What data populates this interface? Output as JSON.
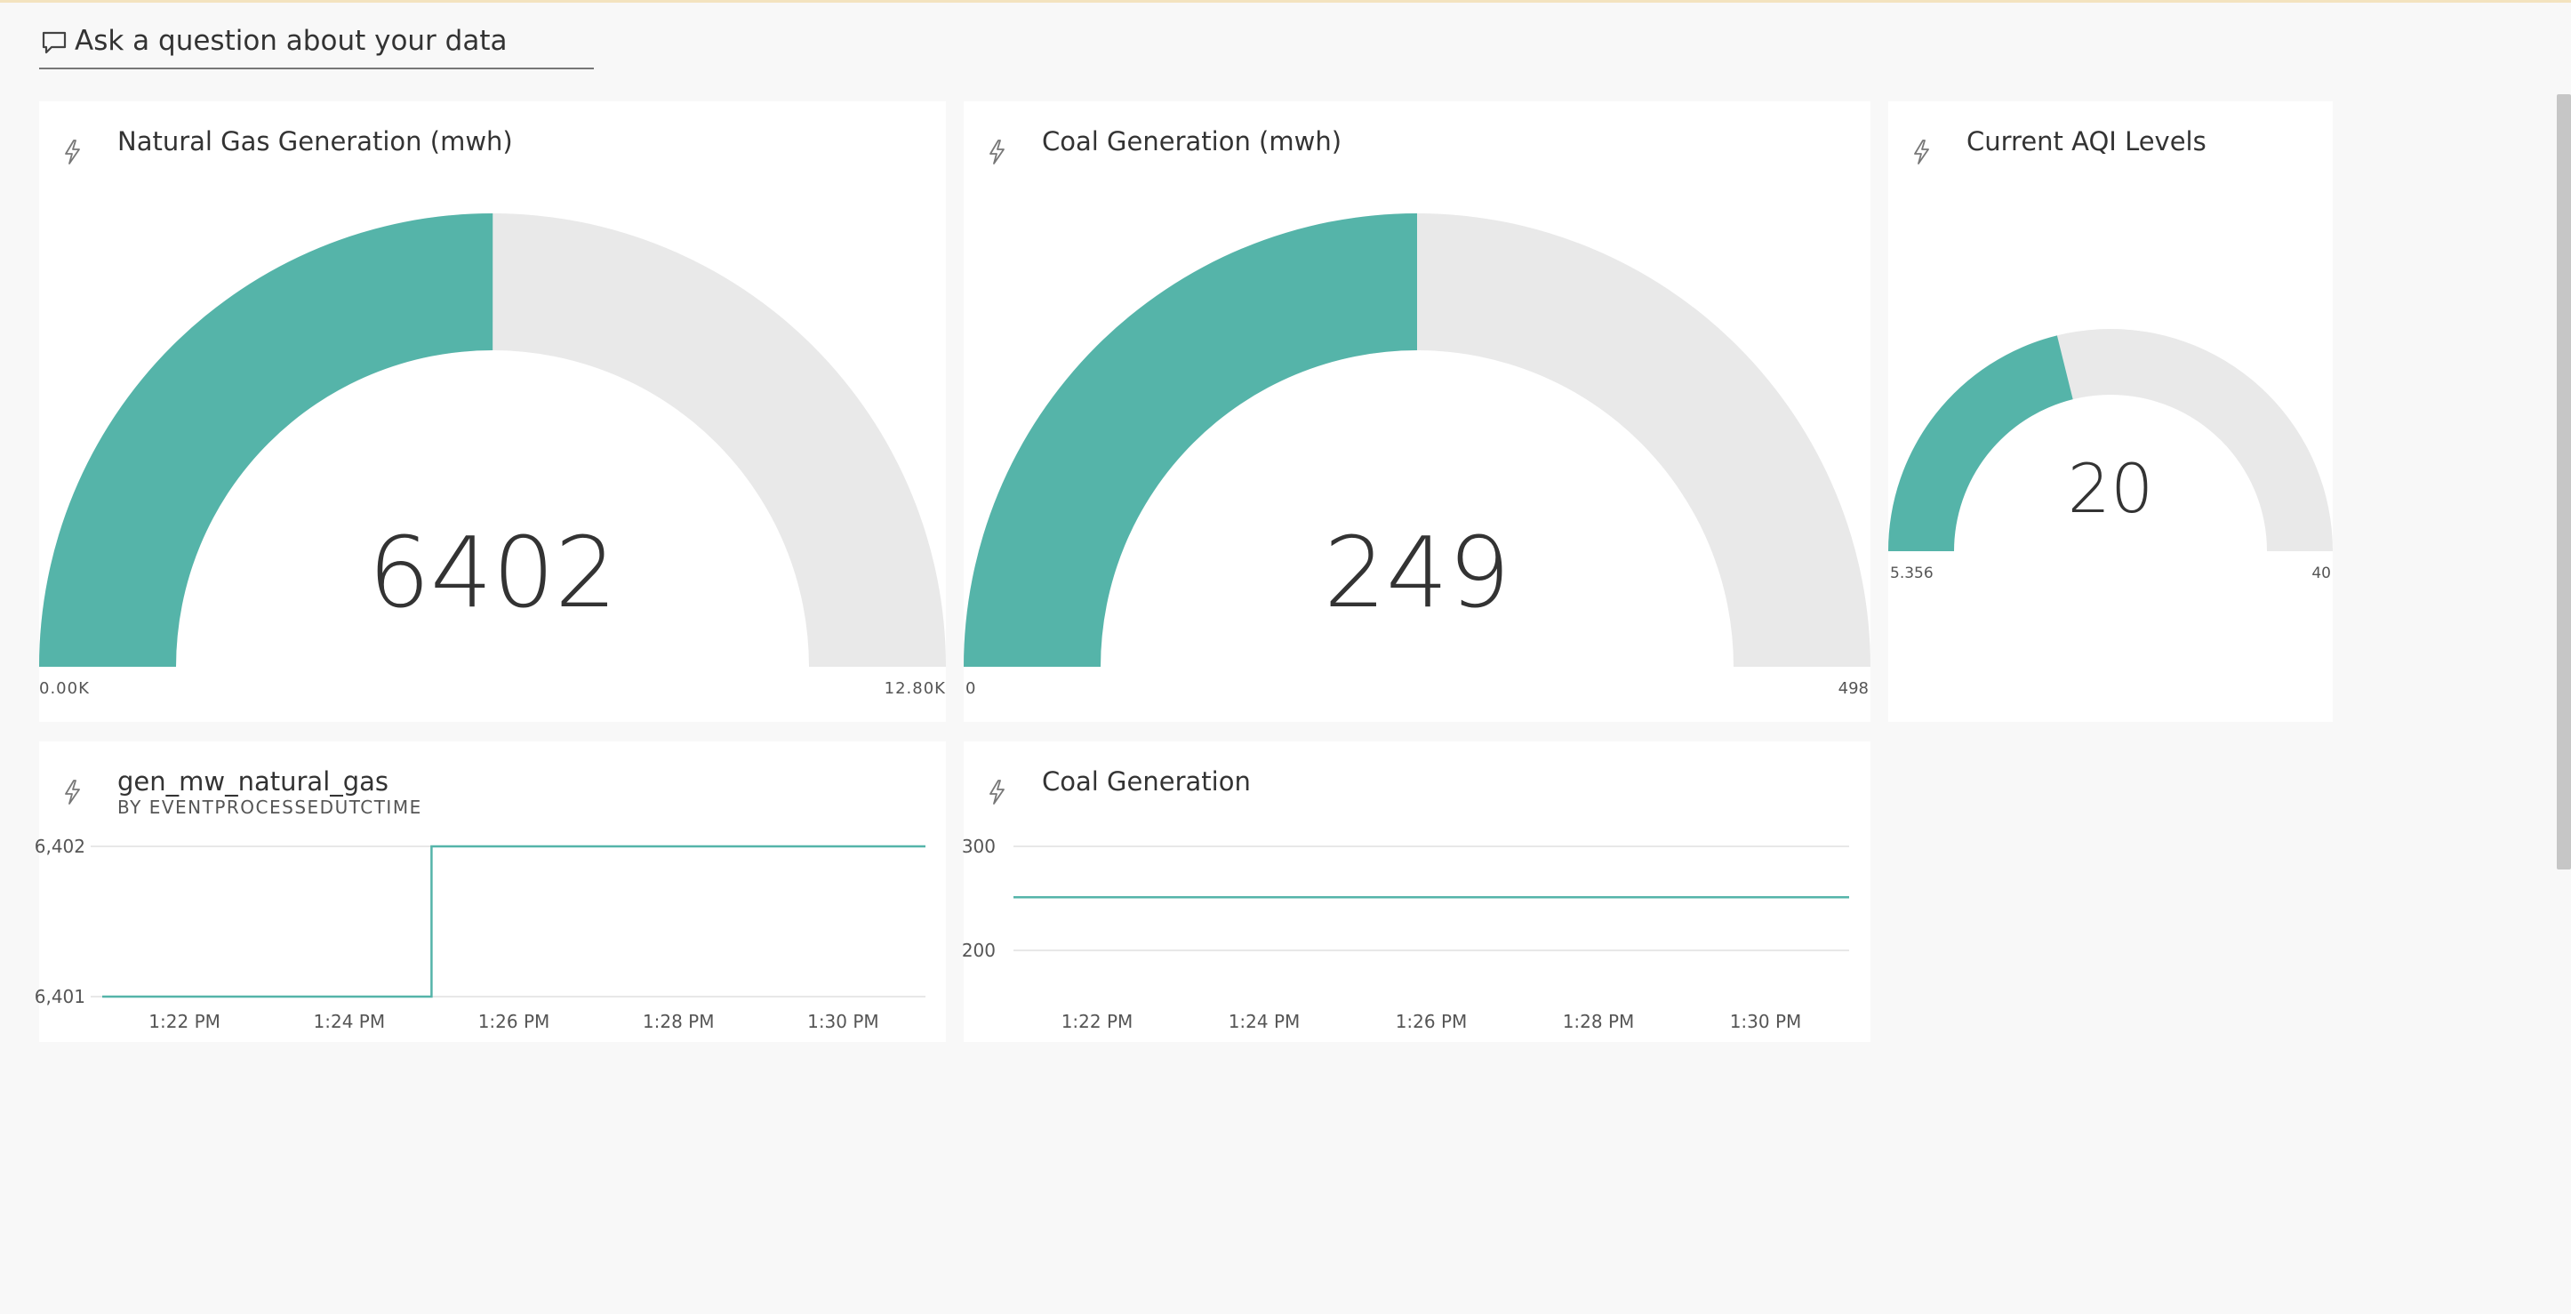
{
  "qa": {
    "placeholder": "Ask a question about your data"
  },
  "colors": {
    "accent": "#55b4a9",
    "track": "#e9e9e9",
    "grid": "#e1e1e1"
  },
  "icons": {
    "question_box": "chat-bubble-icon",
    "tile_badge": "lightning-bolt-icon"
  },
  "tiles": {
    "natural_gas": {
      "title": "Natural Gas Generation (mwh)",
      "value": "6402",
      "min_label": "0.00K",
      "max_label": "12.80K",
      "min": 0,
      "max": 12800,
      "current": 6402
    },
    "coal": {
      "title": "Coal Generation (mwh)",
      "value": "249",
      "min_label": "0",
      "max_label": "498",
      "min": 0,
      "max": 498,
      "current": 249
    },
    "aqi": {
      "title": "Current AQI Levels",
      "value": "20",
      "min_label": "5.356",
      "max_label": "40",
      "min": 5.356,
      "max": 40,
      "current": 20
    },
    "gen_line": {
      "title": "gen_mw_natural_gas",
      "subtitle": "BY EVENTPROCESSEDUTCTIME"
    },
    "coal_line": {
      "title": "Coal Generation"
    }
  },
  "chart_data": [
    {
      "type": "gauge",
      "title": "Natural Gas Generation (mwh)",
      "value": 6402,
      "min": 0,
      "max": 12800,
      "value_label": "6402",
      "min_label": "0.00K",
      "max_label": "12.80K"
    },
    {
      "type": "gauge",
      "title": "Coal Generation (mwh)",
      "value": 249,
      "min": 0,
      "max": 498,
      "value_label": "249",
      "min_label": "0",
      "max_label": "498"
    },
    {
      "type": "gauge",
      "title": "Current AQI Levels",
      "value": 20,
      "min": 5.356,
      "max": 40,
      "value_label": "20",
      "min_label": "5.356",
      "max_label": "40"
    },
    {
      "type": "line",
      "title": "gen_mw_natural_gas",
      "subtitle": "BY EVENTPROCESSEDUTCTIME",
      "x_ticks": [
        "1:22 PM",
        "1:24 PM",
        "1:26 PM",
        "1:28 PM",
        "1:30 PM"
      ],
      "y_ticks": [
        "6,402",
        "6,401"
      ],
      "ylim": [
        6401,
        6402
      ],
      "grid": true,
      "series": [
        {
          "x": [
            "1:21 PM",
            "1:25 PM",
            "1:25 PM",
            "1:31 PM"
          ],
          "y": [
            6401,
            6401,
            6402,
            6402
          ]
        }
      ]
    },
    {
      "type": "line",
      "title": "Coal Generation",
      "x_ticks": [
        "1:22 PM",
        "1:24 PM",
        "1:26 PM",
        "1:28 PM",
        "1:30 PM"
      ],
      "y_ticks": [
        "300",
        "200"
      ],
      "ylim": [
        200,
        300
      ],
      "grid": true,
      "series": [
        {
          "x": [
            "1:21 PM",
            "1:31 PM"
          ],
          "y": [
            251,
            251
          ]
        }
      ]
    }
  ]
}
